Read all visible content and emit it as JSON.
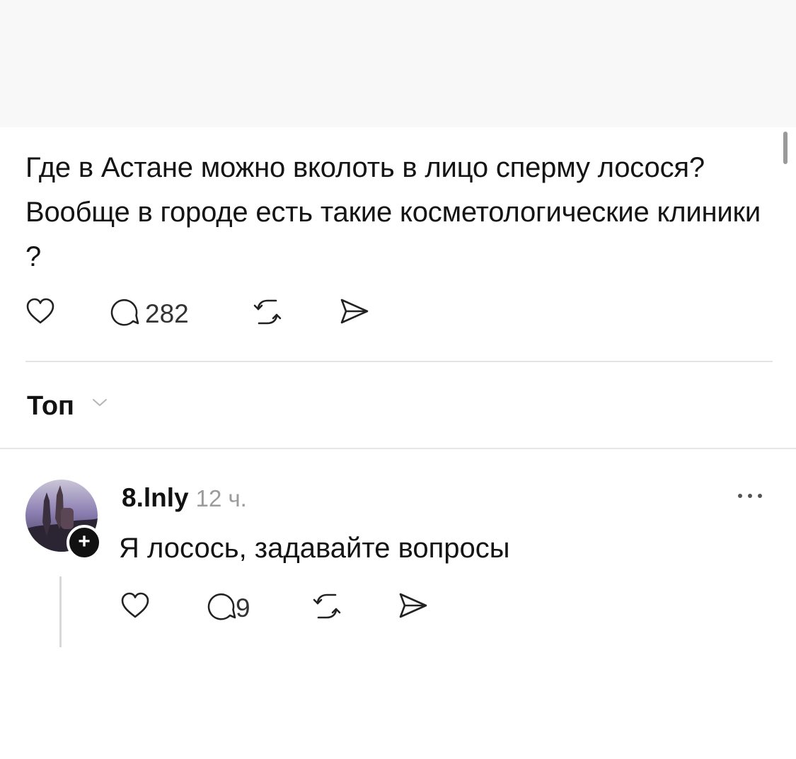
{
  "post": {
    "text": "Где в Астане можно вколоть в лицо сперму лосося? Вообще в городе есть такие косметологические клиники ?",
    "actions": {
      "like_icon": "heart-icon",
      "reply_icon": "comment-icon",
      "reply_count": "282",
      "repost_icon": "repost-icon",
      "share_icon": "send-icon"
    }
  },
  "sort": {
    "label": "Топ",
    "icon": "chevron-down-icon"
  },
  "comment": {
    "username": "8.lnly",
    "timestamp": "12 ч.",
    "text": "Я лосось, задавайте вопросы",
    "more_icon": "more-dots-icon",
    "follow_icon": "plus-icon",
    "follow_symbol": "+",
    "actions": {
      "like_icon": "heart-icon",
      "reply_icon": "comment-icon",
      "reply_count": "9",
      "repost_icon": "repost-icon",
      "share_icon": "send-icon"
    }
  },
  "colors": {
    "text": "#141414",
    "muted": "#9b9b9b",
    "divider": "#e3e3e3",
    "background": "#ffffff"
  }
}
